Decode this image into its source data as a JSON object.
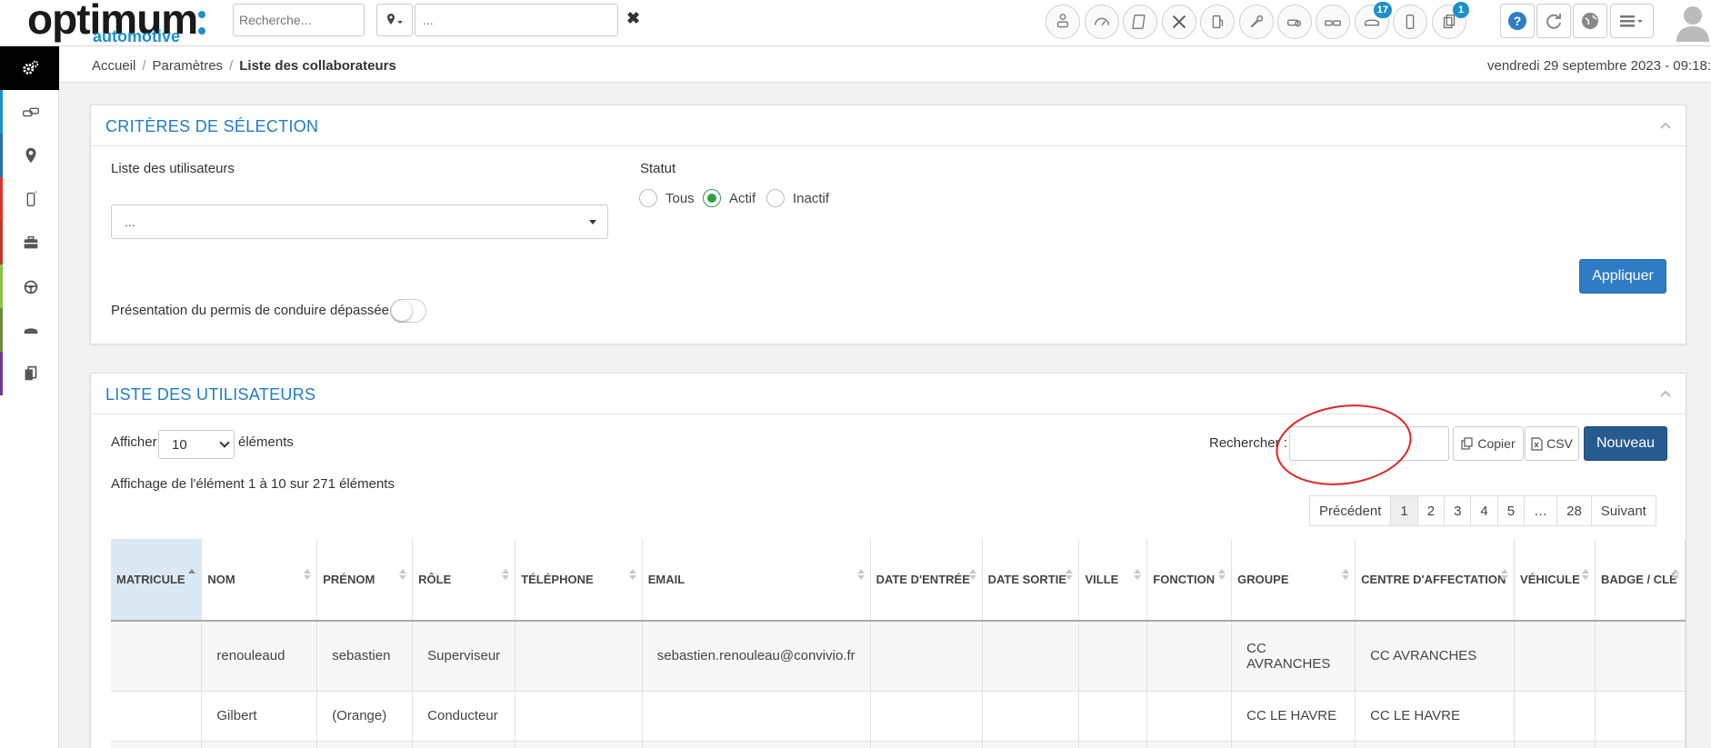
{
  "brand": {
    "name": "optimum",
    "sub": "automotive",
    "color": "#1e90c8"
  },
  "header": {
    "search_placeholder": "Recherche...",
    "location_placeholder": "...",
    "clear": "✖",
    "badges": {
      "notifications": "17",
      "documents": "1"
    }
  },
  "breadcrumb": {
    "home": "Accueil",
    "settings": "Paramètres",
    "current": "Liste des collaborateurs",
    "sep": "/"
  },
  "datetime": "vendredi 29 septembre 2023 - 09:18:",
  "criteria": {
    "title": "CRITÈRES DE SÉLECTION",
    "users_label": "Liste des utilisateurs",
    "users_value": "...",
    "status_label": "Statut",
    "status_options": [
      "Tous",
      "Actif",
      "Inactif"
    ],
    "status_selected": "Actif",
    "apply": "Appliquer",
    "license_label": "Présentation du permis de conduire dépassée",
    "license_toggle": false
  },
  "list": {
    "title": "LISTE DES UTILISATEURS",
    "show_label": "Afficher",
    "show_value": "10",
    "items_label": "éléments",
    "search_label": "Rechercher :",
    "copy": "Copier",
    "csv": "CSV",
    "new": "Nouveau",
    "info": "Affichage de l'élément 1 à 10 sur 271 éléments",
    "pager": {
      "prev": "Précédent",
      "pages": [
        "1",
        "2",
        "3",
        "4",
        "5",
        "…",
        "28"
      ],
      "next": "Suivant",
      "current": "1"
    },
    "columns": [
      "MATRICULE",
      "NOM",
      "PRÉNOM",
      "RÔLE",
      "TÉLÉPHONE",
      "EMAIL",
      "DATE D'ENTRÉE",
      "DATE SORTIE",
      "VILLE",
      "FONCTION",
      "GROUPE",
      "CENTRE D'AFFECTATION",
      "VÉHICULE",
      "BADGE / CLÉ"
    ],
    "rows": [
      {
        "matricule": "",
        "nom": "renouleaud",
        "prenom": "sebastien",
        "role": "Superviseur",
        "telephone": "",
        "email": "sebastien.renouleau@convivio.fr",
        "date_entree": "",
        "date_sortie": "",
        "ville": "",
        "fonction": "",
        "groupe": "CC AVRANCHES",
        "centre": "CC AVRANCHES",
        "vehicule": "",
        "badge": ""
      },
      {
        "matricule": "",
        "nom": "Gilbert",
        "prenom": "(Orange)",
        "role": "Conducteur",
        "telephone": "",
        "email": "",
        "date_entree": "",
        "date_sortie": "",
        "ville": "",
        "fonction": "",
        "groupe": "CC LE HAVRE",
        "centre": "CC LE HAVRE",
        "vehicule": "",
        "badge": ""
      }
    ]
  },
  "colors": {
    "accent": "#2f7cc4",
    "title": "#1e7cc4",
    "radio_on": "#2e9e4a",
    "annotation": "#e32222"
  }
}
